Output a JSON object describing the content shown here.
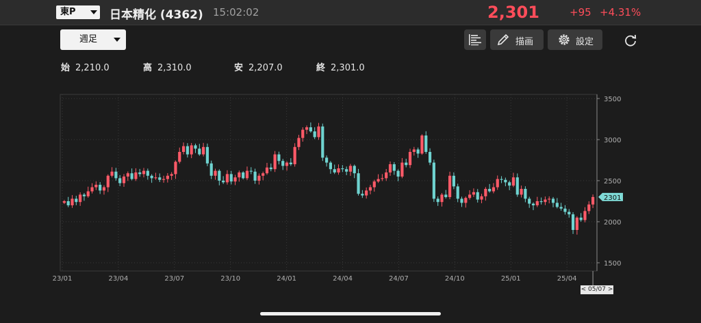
{
  "header": {
    "market": "東P",
    "stock_name": "日本精化 (4362)",
    "time": "15:02:02",
    "price": "2,301",
    "change": "+95",
    "change_pct": "+4.31%"
  },
  "toolbar": {
    "period": "週足",
    "draw_label": "描画",
    "settings_label": "設定",
    "icons": [
      "indicator-list-icon",
      "pencil-icon",
      "gear-icon",
      "refresh-icon"
    ]
  },
  "ohlc": [
    {
      "label": "始",
      "value": "2,210.0"
    },
    {
      "label": "高",
      "value": "2,310.0"
    },
    {
      "label": "安",
      "value": "2,207.0"
    },
    {
      "label": "終",
      "value": "2,301.0"
    }
  ],
  "colors": {
    "up": "#ff5a68",
    "down": "#6fd3d0",
    "accent": "#ff4d5a"
  },
  "chart_data": {
    "type": "candlestick",
    "ylim": [
      1400,
      3550
    ],
    "yticks": [
      1500,
      2000,
      2500,
      3000,
      3500
    ],
    "xticks": [
      "23/01",
      "23/04",
      "23/07",
      "23/10",
      "24/01",
      "24/04",
      "24/07",
      "24/10",
      "25/01",
      "25/04"
    ],
    "last_price_label": "2301",
    "cursor_date": "< 05/07 >",
    "grid": true,
    "closes": [
      2250,
      2200,
      2280,
      2240,
      2330,
      2310,
      2370,
      2420,
      2450,
      2380,
      2420,
      2560,
      2610,
      2530,
      2470,
      2550,
      2590,
      2520,
      2600,
      2580,
      2620,
      2560,
      2530,
      2540,
      2510,
      2520,
      2560,
      2580,
      2730,
      2850,
      2920,
      2820,
      2930,
      2890,
      2820,
      2910,
      2710,
      2560,
      2620,
      2500,
      2480,
      2580,
      2490,
      2540,
      2600,
      2530,
      2620,
      2610,
      2500,
      2560,
      2590,
      2660,
      2640,
      2820,
      2740,
      2680,
      2720,
      2700,
      2910,
      3020,
      3120,
      3150,
      3100,
      3030,
      3160,
      2780,
      2720,
      2640,
      2600,
      2650,
      2640,
      2610,
      2680,
      2590,
      2340,
      2320,
      2380,
      2420,
      2490,
      2520,
      2530,
      2600,
      2700,
      2620,
      2550,
      2720,
      2690,
      2850,
      2880,
      2830,
      3050,
      2850,
      2720,
      2280,
      2240,
      2330,
      2300,
      2560,
      2430,
      2280,
      2230,
      2290,
      2330,
      2360,
      2270,
      2310,
      2400,
      2370,
      2420,
      2520,
      2510,
      2480,
      2440,
      2540,
      2330,
      2400,
      2280,
      2220,
      2200,
      2250,
      2240,
      2270,
      2280,
      2230,
      2180,
      2160,
      2120,
      2090,
      1900,
      2050,
      2020,
      2130,
      2210,
      2301
    ]
  }
}
